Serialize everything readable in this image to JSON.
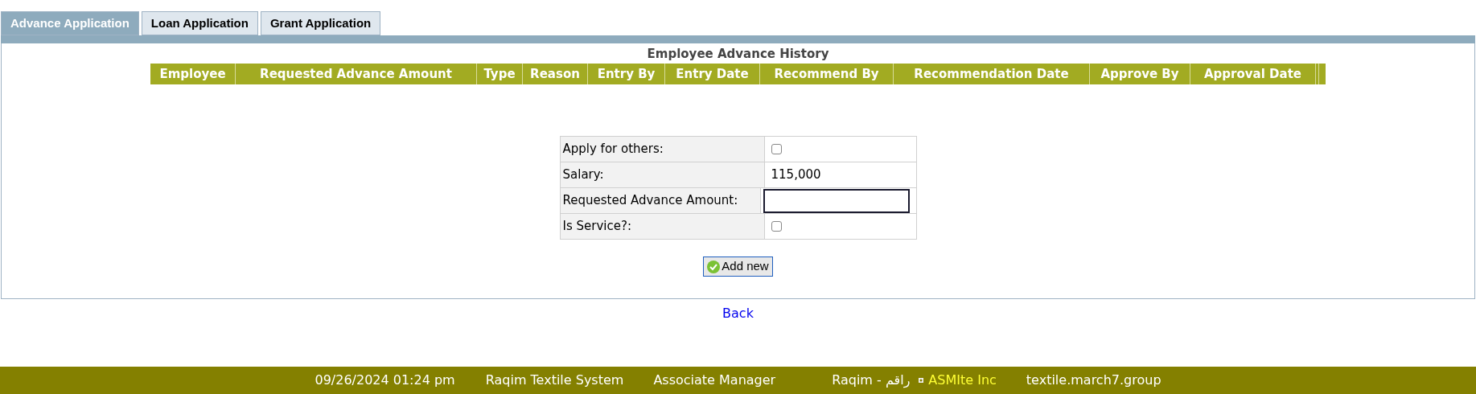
{
  "tabs": [
    {
      "label": "Advance Application",
      "selected": true
    },
    {
      "label": "Loan Application",
      "selected": false
    },
    {
      "label": "Grant Application",
      "selected": false
    }
  ],
  "history": {
    "title": "Employee Advance History",
    "columns": [
      "Employee",
      "Requested Advance Amount",
      "Type",
      "Reason",
      "Entry By",
      "Entry Date",
      "Recommend By",
      "Recommendation Date",
      "Approve By",
      "Approval Date"
    ]
  },
  "form": {
    "rows": [
      {
        "kind": "checkbox",
        "label": "Apply for others:",
        "checked": false
      },
      {
        "kind": "text",
        "label": "Salary:",
        "value": "115,000"
      },
      {
        "kind": "input",
        "label": "Requested Advance Amount:"
      },
      {
        "kind": "checkbox",
        "label": "Is Service?:",
        "checked": false
      }
    ],
    "button": "Add new"
  },
  "back_link": "Back",
  "status_bar": {
    "date": "09/26/2024 01:24 pm",
    "system": "Raqim Textile System",
    "role": "Associate Manager",
    "user": "Raqim - راقم",
    "company": "ASMIte Inc",
    "domain": "textile.march7.group"
  }
}
